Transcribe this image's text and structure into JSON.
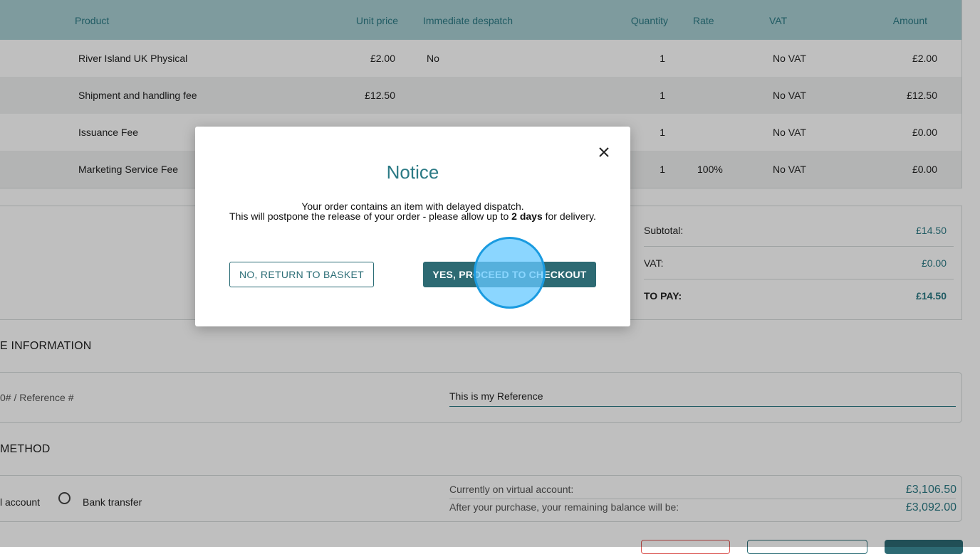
{
  "table": {
    "headers": {
      "product": "Product",
      "unit_price": "Unit price",
      "immediate_despatch": "Immediate despatch",
      "quantity": "Quantity",
      "rate": "Rate",
      "vat": "VAT",
      "amount": "Amount"
    },
    "rows": [
      {
        "product": "River Island UK Physical",
        "unit_price": "£2.00",
        "immediate_despatch": "No",
        "quantity": "1",
        "rate": "",
        "vat": "No VAT",
        "amount": "£2.00"
      },
      {
        "product": "Shipment and handling fee",
        "unit_price": "£12.50",
        "immediate_despatch": "",
        "quantity": "1",
        "rate": "",
        "vat": "No VAT",
        "amount": "£12.50"
      },
      {
        "product": "Issuance Fee",
        "unit_price": "",
        "immediate_despatch": "",
        "quantity": "1",
        "rate": "",
        "vat": "No VAT",
        "amount": "£0.00"
      },
      {
        "product": "Marketing Service Fee",
        "unit_price": "",
        "immediate_despatch": "",
        "quantity": "1",
        "rate": "100%",
        "vat": "No VAT",
        "amount": "£0.00"
      }
    ]
  },
  "totals": {
    "subtotal_label": "Subtotal:",
    "subtotal_value": "£14.50",
    "vat_label": "VAT:",
    "vat_value": "£0.00",
    "topay_label": "TO PAY:",
    "topay_value": "£14.50"
  },
  "info": {
    "title": "E INFORMATION",
    "reference_label": "0# / Reference #",
    "reference_value": "This is my Reference"
  },
  "payment": {
    "title": "METHOD",
    "option_virtual": "l account",
    "option_bank": "Bank transfer",
    "current_label": "Currently on virtual account:",
    "current_value": "£3,106.50",
    "after_label": "After your purchase, your remaining balance will be:",
    "after_value": "£3,092.00"
  },
  "modal": {
    "title": "Notice",
    "line1": "Your order contains an item with delayed dispatch.",
    "line2_before": "This will postpone the release of your order - please allow up to ",
    "line2_bold": "2 days",
    "line2_after": " for delivery.",
    "no_button": "NO, RETURN TO BASKET",
    "yes_button": "YES, PROCEED TO CHECKOUT",
    "close_icon": "close-icon"
  },
  "colors": {
    "accent": "#2b7a85",
    "header_bg": "#a9cfd3",
    "primary_button": "#2d6a73",
    "click_indicator": "#1a9be0"
  }
}
